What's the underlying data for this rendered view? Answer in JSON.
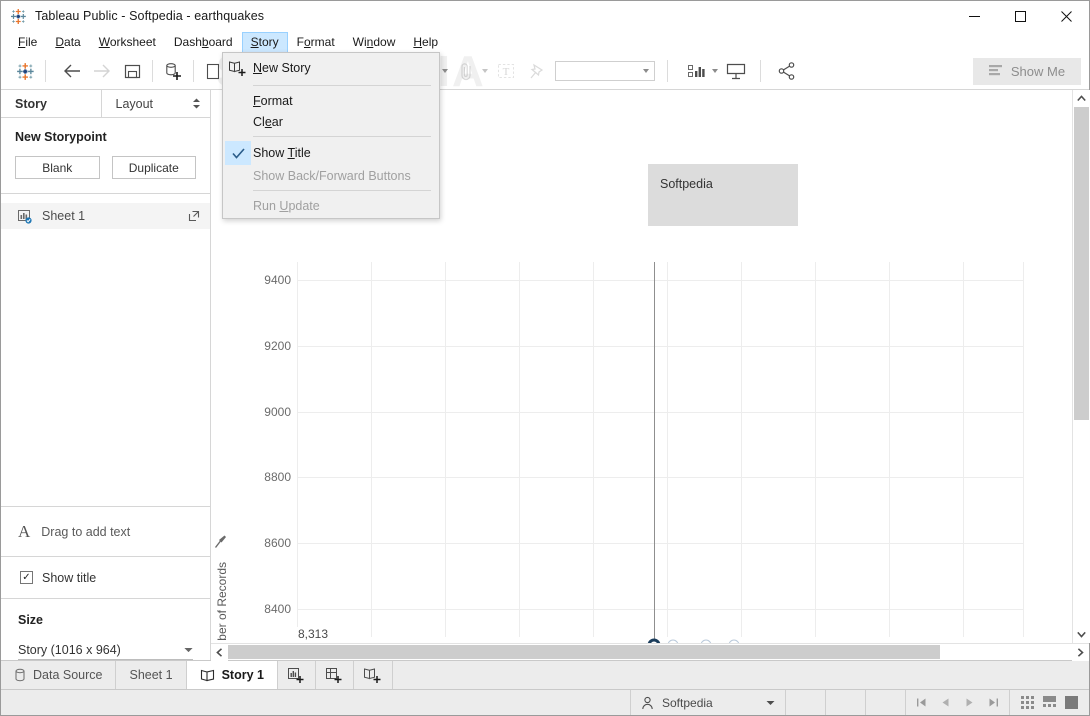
{
  "window": {
    "title": "Tableau Public - Softpedia - earthquakes",
    "app_icon": "tableau-logo-icon",
    "minimize_label": "—",
    "maximize_label": "□",
    "close_label": "✕"
  },
  "menubar": {
    "items": [
      {
        "label": "File",
        "accel": "F",
        "active": false
      },
      {
        "label": "Data",
        "accel": "D",
        "active": false
      },
      {
        "label": "Worksheet",
        "accel": "W",
        "active": false
      },
      {
        "label": "Dashboard",
        "accel": "b",
        "active": false
      },
      {
        "label": "Story",
        "accel": "S",
        "active": true
      },
      {
        "label": "Format",
        "accel": "o",
        "active": false
      },
      {
        "label": "Window",
        "accel": "n",
        "active": false
      },
      {
        "label": "Help",
        "accel": "H",
        "active": false
      }
    ]
  },
  "story_menu": {
    "open": true,
    "items": [
      {
        "label": "New Story",
        "icon": "new-story-icon",
        "enabled": true,
        "checked": false,
        "separator_after": true
      },
      {
        "label": "Format",
        "icon": "",
        "enabled": true,
        "checked": false,
        "separator_after": false
      },
      {
        "label": "Clear",
        "icon": "",
        "enabled": true,
        "checked": false,
        "separator_after": true
      },
      {
        "label": "Show Title",
        "icon": "",
        "enabled": true,
        "checked": true,
        "separator_after": false
      },
      {
        "label": "Show Back/Forward Buttons",
        "icon": "",
        "enabled": false,
        "checked": false,
        "separator_after": true
      },
      {
        "label": "Run Update",
        "icon": "",
        "enabled": false,
        "checked": false,
        "separator_after": false
      }
    ]
  },
  "toolbar": {
    "watermark": "SOFTPEDIA",
    "buttons": [
      {
        "name": "tableau-logo-icon",
        "enabled": true
      },
      {
        "name": "back-arrow-icon",
        "enabled": true
      },
      {
        "name": "forward-arrow-icon",
        "enabled": false
      },
      {
        "name": "save-icon",
        "enabled": true
      },
      {
        "name": "new-data-source-icon",
        "enabled": true
      },
      {
        "name": "new-worksheet-icon",
        "enabled": true
      },
      {
        "name": "new-dashboard-icon",
        "enabled": true
      },
      {
        "name": "new-story-icon",
        "enabled": true
      },
      {
        "name": "duplicate-icon",
        "enabled": false
      },
      {
        "name": "clear-sheet-icon",
        "enabled": false
      },
      {
        "name": "undo-icon",
        "enabled": false
      },
      {
        "name": "swap-icon",
        "enabled": false
      },
      {
        "name": "highlighter-icon",
        "enabled": true
      },
      {
        "name": "attachment-icon",
        "enabled": false
      },
      {
        "name": "text-box-icon",
        "enabled": false
      },
      {
        "name": "pin-icon",
        "enabled": false
      },
      {
        "name": "fit-combo",
        "enabled": true
      },
      {
        "name": "show-cards-icon",
        "enabled": true
      },
      {
        "name": "presentation-mode-icon",
        "enabled": true
      },
      {
        "name": "share-icon",
        "enabled": true
      }
    ],
    "fit_value": "",
    "show_me_label": "Show Me",
    "show_me_icon": "show-me-icon"
  },
  "sidebar": {
    "tabs": [
      {
        "label": "Story",
        "active": true
      },
      {
        "label": "Layout",
        "active": false
      }
    ],
    "new_storypoint": {
      "heading": "New Storypoint",
      "blank_label": "Blank",
      "duplicate_label": "Duplicate"
    },
    "sheets": [
      {
        "label": "Sheet 1",
        "icon": "worksheet-icon",
        "action_icon": "open-external-icon"
      }
    ],
    "drag_text": {
      "label": "Drag to add text",
      "icon": "text-A-icon"
    },
    "show_title": {
      "label": "Show title",
      "checked": true
    },
    "size": {
      "heading": "Size",
      "value": "Story (1016 x 964)"
    }
  },
  "canvas": {
    "story_title": "Softpedia",
    "axis_pin_icon": "pin-icon"
  },
  "chart_data": {
    "type": "scatter",
    "title": "",
    "xlabel": "",
    "ylabel": "Number of Records",
    "ylabel_truncated": "ber of Records",
    "yticks": [
      8400,
      8600,
      8800,
      9000,
      9200,
      9400
    ],
    "ylim": [
      8300,
      9480
    ],
    "grid": true,
    "reference_line": {
      "value": 8313,
      "label": "8,313"
    },
    "points": [
      {
        "y": 8313,
        "selected": true
      },
      {
        "y": 8313,
        "selected": false
      },
      {
        "y": 8313,
        "selected": false
      },
      {
        "y": 8313,
        "selected": false
      }
    ]
  },
  "scrollbars": {
    "vertical": {
      "up_icon": "chevron-up-icon",
      "down_icon": "chevron-down-icon"
    },
    "horizontal": {
      "left_icon": "chevron-left-icon",
      "right_icon": "chevron-right-icon"
    }
  },
  "bottom_tabs": [
    {
      "label": "Data Source",
      "icon": "data-source-icon",
      "active": false
    },
    {
      "label": "Sheet 1",
      "icon": "",
      "active": false
    },
    {
      "label": "Story 1",
      "icon": "story-icon",
      "active": true
    },
    {
      "label": "",
      "icon": "new-worksheet-icon",
      "active": false
    },
    {
      "label": "",
      "icon": "new-dashboard-icon",
      "active": false
    },
    {
      "label": "",
      "icon": "new-story-icon",
      "active": false
    }
  ],
  "statusbar": {
    "user": "Softpedia",
    "user_icon": "user-icon",
    "nav": [
      "first-icon",
      "prev-icon",
      "next-icon",
      "last-icon"
    ],
    "views": [
      "grid-view-icon",
      "filmstrip-view-icon",
      "single-view-icon"
    ]
  }
}
